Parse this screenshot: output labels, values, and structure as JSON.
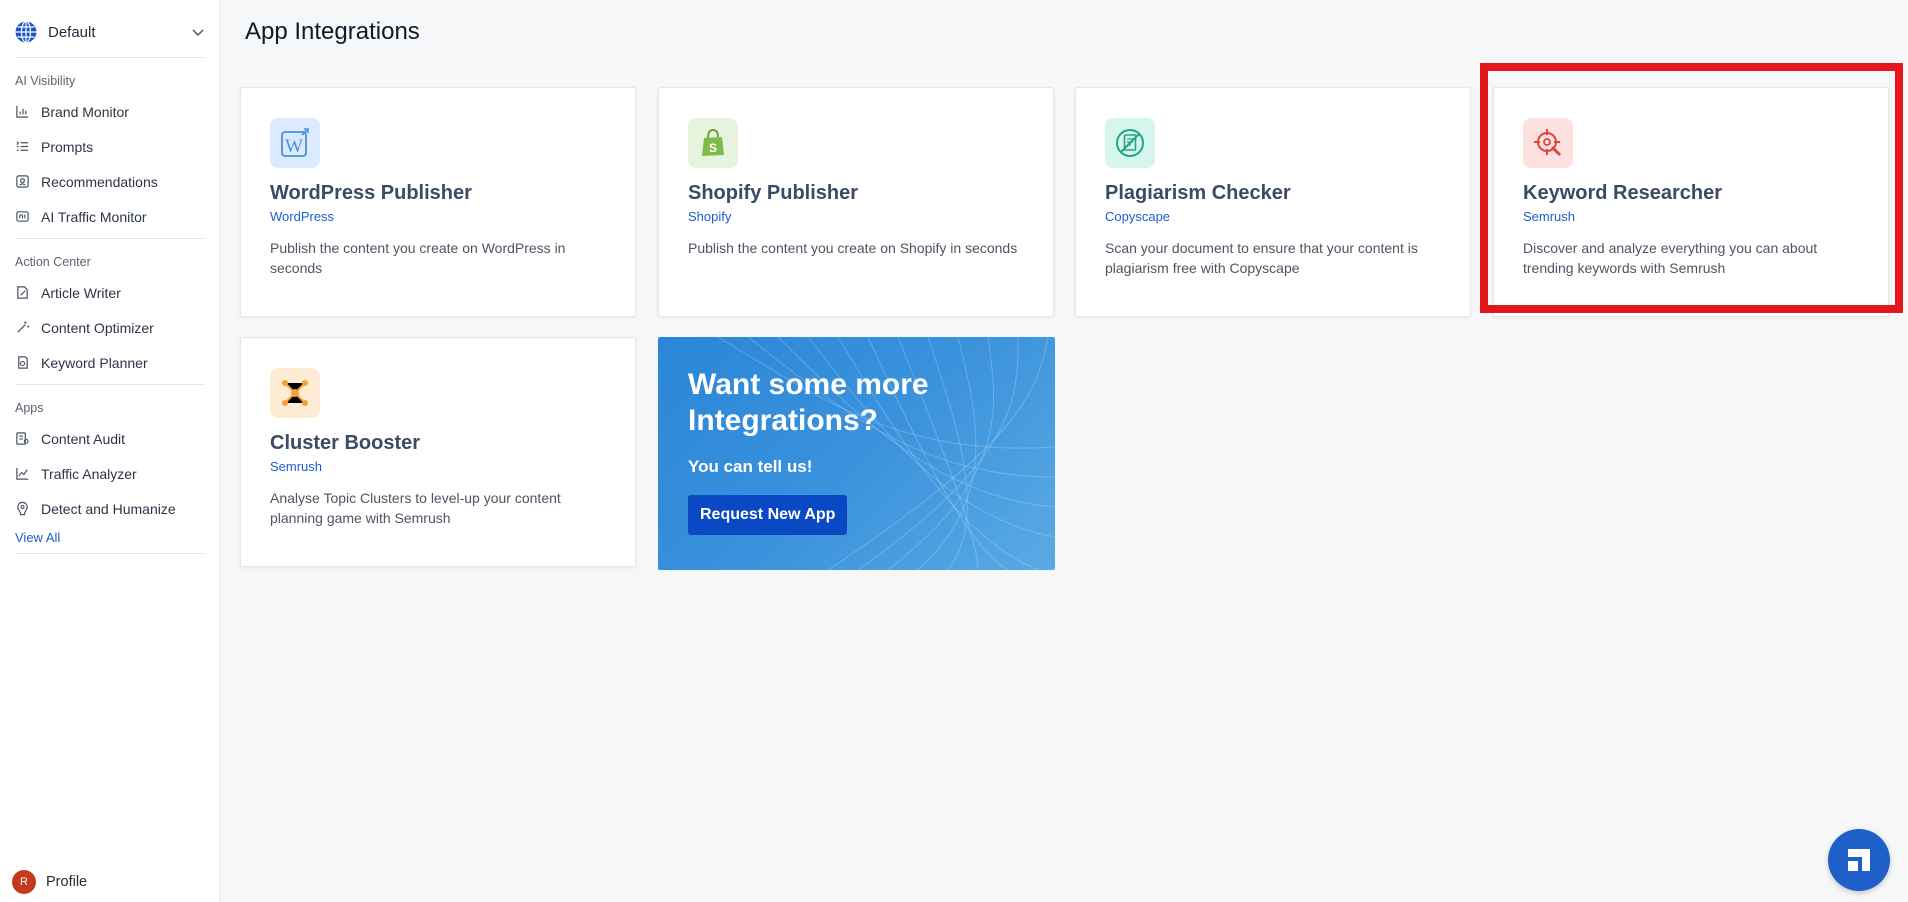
{
  "sidebar": {
    "workspace": "Default",
    "sections": [
      {
        "title": "AI Visibility",
        "items": [
          {
            "label": "Brand Monitor",
            "icon": "bar-chart-icon"
          },
          {
            "label": "Prompts",
            "icon": "list-icon"
          },
          {
            "label": "Recommendations",
            "icon": "recommendations-icon"
          },
          {
            "label": "AI Traffic Monitor",
            "icon": "ai-traffic-icon"
          }
        ]
      },
      {
        "title": "Action Center",
        "items": [
          {
            "label": "Article Writer",
            "icon": "article-writer-icon"
          },
          {
            "label": "Content Optimizer",
            "icon": "magic-wand-icon"
          },
          {
            "label": "Keyword Planner",
            "icon": "keyword-planner-icon"
          }
        ]
      },
      {
        "title": "Apps",
        "items": [
          {
            "label": "Content Audit",
            "icon": "content-audit-icon"
          },
          {
            "label": "Traffic Analyzer",
            "icon": "line-chart-icon"
          },
          {
            "label": "Detect and Humanize",
            "icon": "detect-humanize-icon"
          }
        ]
      }
    ],
    "view_all": "View All",
    "profile": {
      "initial": "R",
      "label": "Profile",
      "avatar_color": "#c53a1d"
    }
  },
  "main": {
    "title": "App Integrations",
    "cards": [
      {
        "title": "WordPress Publisher",
        "provider": "WordPress",
        "description": "Publish the content you create on WordPress in seconds",
        "icon": "wordpress-icon",
        "tile_color": "#dbeafe"
      },
      {
        "title": "Shopify Publisher",
        "provider": "Shopify",
        "description": "Publish the content you create on Shopify in seconds",
        "icon": "shopify-icon",
        "tile_color": "#e8f3de"
      },
      {
        "title": "Plagiarism Checker",
        "provider": "Copyscape",
        "description": "Scan your document to ensure that your content is plagiarism free with Copyscape",
        "icon": "plagiarism-icon",
        "tile_color": "#d6f5ec"
      },
      {
        "title": "Keyword Researcher",
        "provider": "Semrush",
        "description": "Discover and analyze everything you can about trending keywords with Semrush",
        "icon": "keyword-target-icon",
        "tile_color": "#fde0e0"
      },
      {
        "title": "Cluster Booster",
        "provider": "Semrush",
        "description": "Analyse Topic Clusters to level-up your content planning game with Semrush",
        "icon": "cluster-icon",
        "tile_color": "#fdebd3"
      }
    ],
    "promo": {
      "title": "Want some more Integrations?",
      "subtitle": "You can tell us!",
      "button": "Request New App"
    }
  },
  "colors": {
    "accent_link": "#1a5fd1",
    "highlight": "#e3161b",
    "promo_button": "#0b48c4",
    "chat_fab": "#1f5fc9"
  },
  "chat_fab_icon": "chat-widget-icon"
}
